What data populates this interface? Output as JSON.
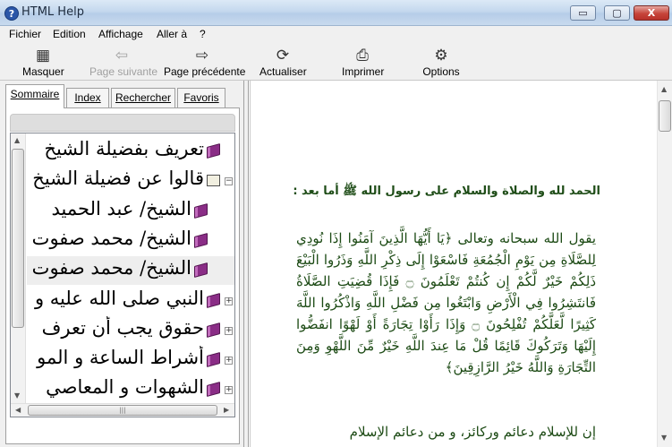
{
  "window": {
    "title": "HTML Help",
    "app_icon_glyph": "?",
    "minimize_glyph": "▭",
    "maximize_glyph": "▢",
    "close_glyph": "X"
  },
  "menu": {
    "items": [
      "Fichier",
      "Edition",
      "Affichage",
      "Aller à",
      "?"
    ]
  },
  "toolbar": {
    "items": [
      {
        "label": "Masquer",
        "icon": "hide-pane-icon",
        "enabled": true
      },
      {
        "label": "Page suivante",
        "icon": "arrow-left-icon",
        "enabled": false
      },
      {
        "label": "Page précédente",
        "icon": "arrow-right-icon",
        "enabled": true
      },
      {
        "label": "Actualiser",
        "icon": "refresh-icon",
        "enabled": true
      },
      {
        "label": "Imprimer",
        "icon": "printer-icon",
        "enabled": true
      },
      {
        "label": "Options",
        "icon": "options-icon",
        "enabled": true
      }
    ]
  },
  "nav": {
    "tabs": [
      {
        "label": "Sommaire",
        "active": true
      },
      {
        "label": "Index",
        "active": false
      },
      {
        "label": "Rechercher",
        "active": false
      },
      {
        "label": "Favoris",
        "active": false
      }
    ],
    "tree": [
      {
        "text": "تعريف بفضيلة الشيخ",
        "level": 0,
        "icon": "closed-book",
        "expandable": false
      },
      {
        "text": "قالوا عن فضيلة الشيخ",
        "level": 0,
        "icon": "open-book",
        "expandable": true,
        "expanded": true
      },
      {
        "text": "الشيخ/ عبد الحميد",
        "level": 1,
        "icon": "closed-book",
        "expandable": false
      },
      {
        "text": "الشيخ/ محمد صفوت",
        "level": 1,
        "icon": "closed-book",
        "expandable": false
      },
      {
        "text": "الشيخ/ محمد صفوت",
        "level": 1,
        "icon": "closed-book",
        "expandable": false
      },
      {
        "text": "النبي صلى الله عليه و",
        "level": 0,
        "icon": "closed-book",
        "expandable": true
      },
      {
        "text": "حقوق يجب أن تعرف",
        "level": 0,
        "icon": "closed-book",
        "expandable": true
      },
      {
        "text": "أشراط الساعة و المو",
        "level": 0,
        "icon": "closed-book",
        "expandable": true
      },
      {
        "text": "الشهوات و المعاصي",
        "level": 0,
        "icon": "closed-book",
        "expandable": true
      }
    ]
  },
  "content": {
    "heading": "الحمد لله والصلاة والسلام على رسول الله ﷺ أما بعد :",
    "verse": "يقول الله سبحانه وتعالى ﴿يَا أَيُّهَا الَّذِينَ آمَنُوا إِذَا نُودِي لِلصَّلَاةِ مِن يَوْمِ الْجُمُعَةِ فَاسْعَوْا إِلَى ذِكْرِ اللَّهِ وَذَرُوا الْبَيْعَ ذَلِكُمْ خَيْرٌ لَّكُمْ إِن كُنتُمْ تَعْلَمُونَ ۝ فَإِذَا قُضِيَتِ الصَّلَاةُ فَانتَشِرُوا فِي الْأَرْضِ وَابْتَغُوا مِن فَضْلِ اللَّهِ وَاذْكُرُوا اللَّهَ كَثِيرًا لَّعَلَّكُمْ تُفْلِحُونَ ۝ وَإِذَا رَأَوْا تِجَارَةً أَوْ لَهْوًا انفَضُّوا إِلَيْهَا وَتَرَكُوكَ قَائِمًا قُلْ مَا عِندَ اللَّهِ خَيْرٌ مِّنَ اللَّهْوِ وَمِنَ التِّجَارَةِ وَاللَّهُ خَيْرُ الرَّازِقِينَ﴾",
    "bottom_text": "إن للإسلام دعائم وركائز، و من دعائم الإسلام"
  },
  "colors": {
    "content_text": "#1c4a14",
    "book_purple": "#8a2d86"
  }
}
